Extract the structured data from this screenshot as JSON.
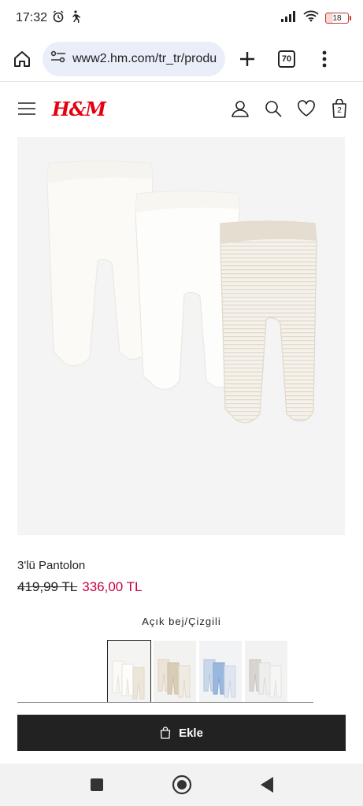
{
  "status_bar": {
    "time": "17:32",
    "battery": "18"
  },
  "browser": {
    "url": "www2.hm.com/tr_tr/produ",
    "tab_count": "70"
  },
  "site": {
    "logo": "H&M",
    "cart_count": "2"
  },
  "product": {
    "name": "3'lü Pantolon",
    "old_price": "419,99 TL",
    "new_price": "336,00 TL",
    "color_name": "Açık bej/Çizgili"
  },
  "actions": {
    "add_label": "Ekle"
  },
  "colors": {
    "sale": "#c6003f",
    "brand": "#e50010",
    "button": "#222222"
  }
}
